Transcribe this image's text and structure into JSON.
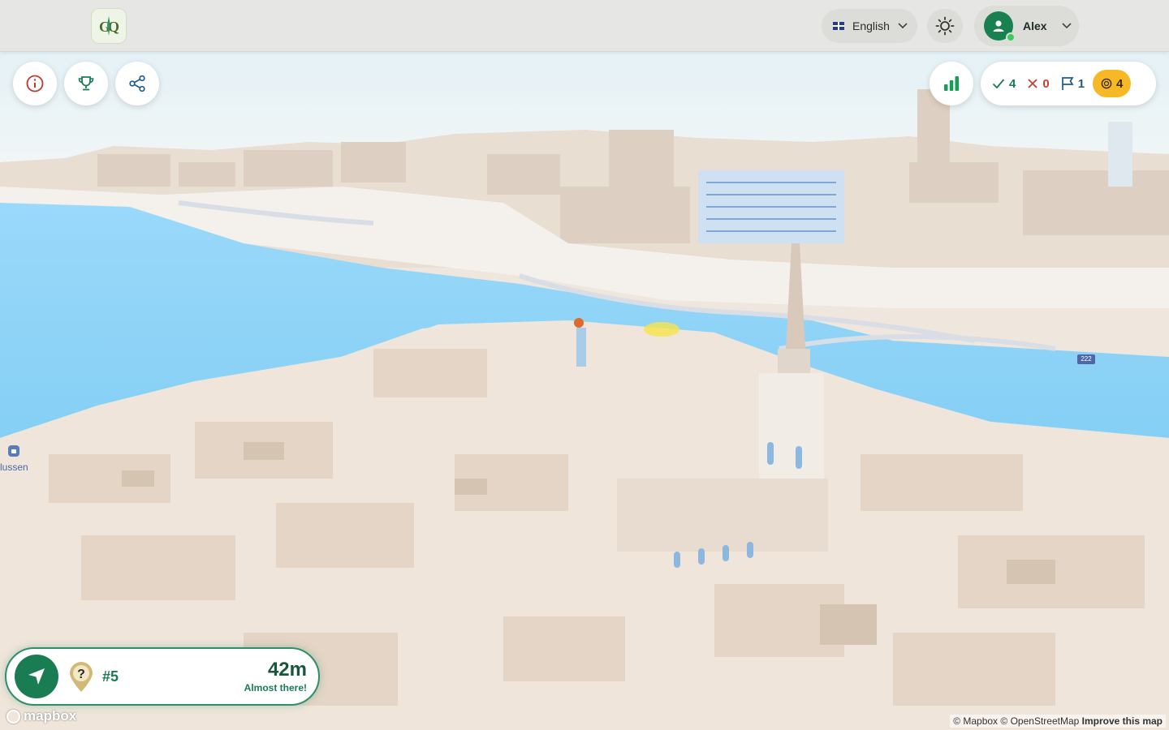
{
  "app": {
    "logo_text": "GQ"
  },
  "header": {
    "language_label": "English",
    "user_name": "Alex"
  },
  "stats": {
    "correct": "4",
    "wrong": "0",
    "flags": "1",
    "coins": "4"
  },
  "navigation": {
    "target_number": "#5",
    "distance": "42m",
    "status": "Almost there!"
  },
  "map": {
    "place_label": "Slussen",
    "place_label_visible": "lussen",
    "route_shield": "222",
    "attribution": {
      "mapbox": "© Mapbox",
      "osm": "© OpenStreetMap",
      "improve": "Improve this map"
    },
    "logo_text": "mapbox"
  },
  "colors": {
    "brand_green": "#1a7c53",
    "coin_yellow": "#f7b825",
    "wrong_red": "#c4432f",
    "flag_blue": "#1e5b8c",
    "water": "#8fd3f7",
    "buildings": "#efe3d6"
  },
  "icons": {
    "info": "info-icon",
    "trophy": "trophy-icon",
    "share": "share-icon",
    "leaderboard": "bar-chart-icon",
    "theme": "sun-icon",
    "navigate": "navigation-arrow-icon",
    "target": "question-pin-icon"
  }
}
